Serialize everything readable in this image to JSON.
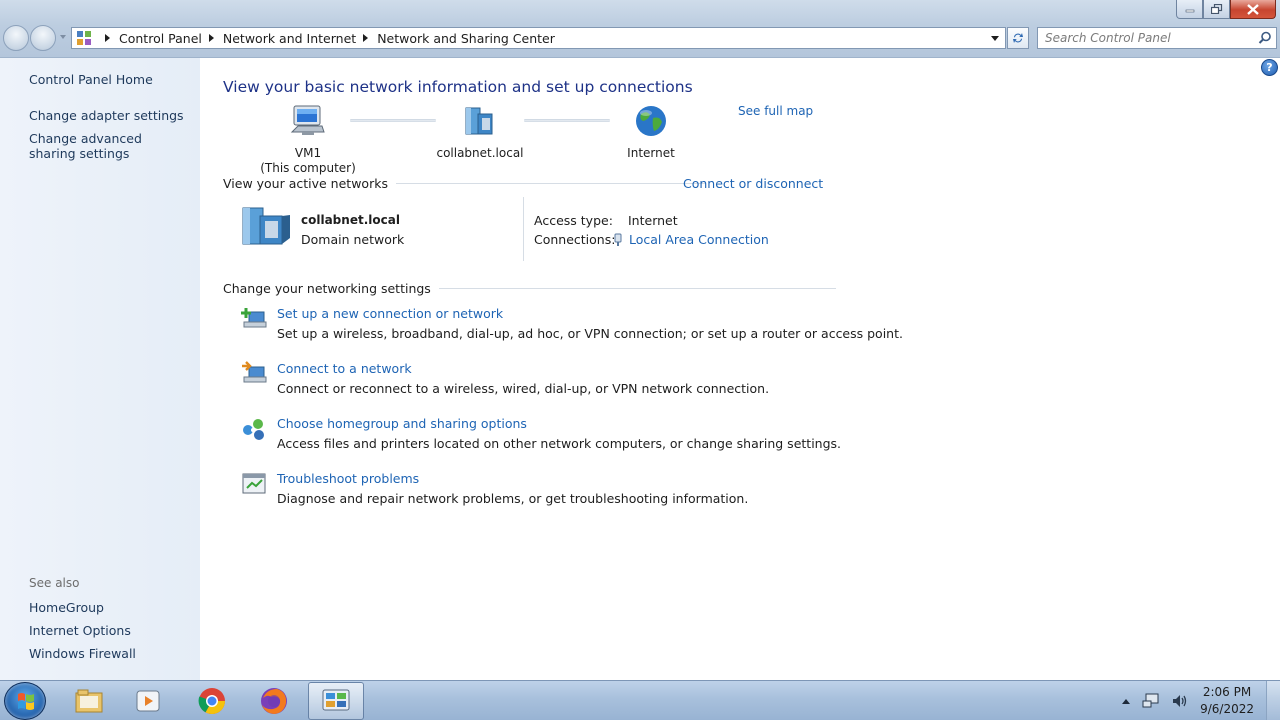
{
  "window": {
    "controls": [
      "minimize",
      "maximize",
      "close"
    ]
  },
  "address_bar": {
    "crumbs": [
      "Control Panel",
      "Network and Internet",
      "Network and Sharing Center"
    ]
  },
  "search": {
    "placeholder": "Search Control Panel"
  },
  "left_pane": {
    "links": [
      "Control Panel Home",
      "Change adapter settings",
      "Change advanced sharing settings"
    ],
    "see_also_heading": "See also",
    "see_also": [
      "HomeGroup",
      "Internet Options",
      "Windows Firewall"
    ]
  },
  "main": {
    "title": "View your basic network information and set up connections",
    "see_full_map": "See full map",
    "network_map": [
      {
        "line1": "VM1",
        "line2": "(This computer)",
        "icon": "computer-icon"
      },
      {
        "line1": "collabnet.local",
        "line2": "",
        "icon": "domain-network-icon"
      },
      {
        "line1": "Internet",
        "line2": "",
        "icon": "globe-icon"
      }
    ],
    "active_networks_heading": "View your active networks",
    "connect_or_disconnect": "Connect or disconnect",
    "active_network": {
      "name": "collabnet.local",
      "type": "Domain network",
      "access_type_label": "Access type:",
      "access_type_value": "Internet",
      "connections_label": "Connections:",
      "connections_value": "Local Area Connection"
    },
    "settings_heading": "Change your networking settings",
    "tasks": [
      {
        "title": "Set up a new connection or network",
        "desc": "Set up a wireless, broadband, dial-up, ad hoc, or VPN connection; or set up a router or access point."
      },
      {
        "title": "Connect to a network",
        "desc": "Connect or reconnect to a wireless, wired, dial-up, or VPN network connection."
      },
      {
        "title": "Choose homegroup and sharing options",
        "desc": "Access files and printers located on other network computers, or change sharing settings."
      },
      {
        "title": "Troubleshoot problems",
        "desc": "Diagnose and repair network problems, or get troubleshooting information."
      }
    ]
  },
  "taskbar": {
    "apps": [
      "windows-explorer",
      "media-player",
      "chrome",
      "firefox",
      "network-and-sharing-center"
    ],
    "active_app": "network-and-sharing-center",
    "clock_time": "2:06 PM",
    "clock_date": "9/6/2022"
  },
  "colors": {
    "link": "#1e64b4",
    "title": "#1e3287",
    "left_pane_link": "#1e395b",
    "left_pane_bg": "#e5edf7"
  }
}
